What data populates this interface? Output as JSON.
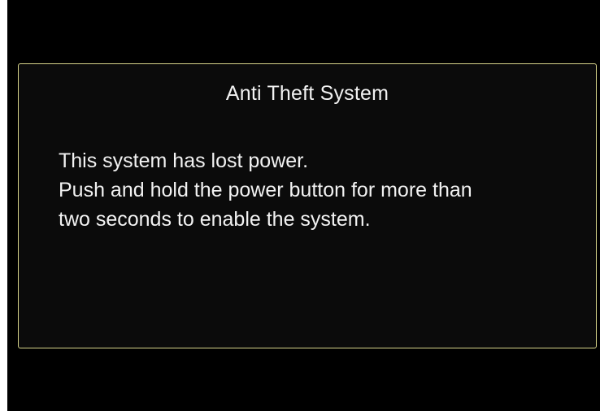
{
  "dialog": {
    "title": "Anti Theft System",
    "lines": [
      "This system has lost power.",
      "Push and hold the power button for more than",
      "two seconds to enable the system."
    ]
  },
  "colors": {
    "background": "#000000",
    "border": "#d7d48a",
    "text": "#f2f2f2"
  }
}
